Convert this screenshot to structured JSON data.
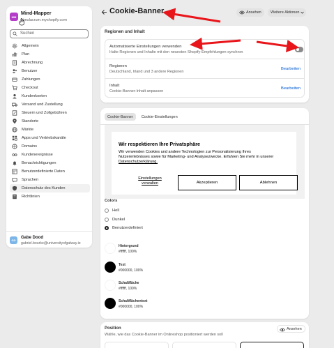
{
  "store": {
    "initials": "MM",
    "name": "Mind-Mapper",
    "url": "simulacrum.myshopify.com"
  },
  "search": {
    "placeholder": "Suchen"
  },
  "nav": [
    {
      "label": "Allgemein",
      "icon": "gear-icon"
    },
    {
      "label": "Plan",
      "icon": "plan-icon"
    },
    {
      "label": "Abrechnung",
      "icon": "billing-icon"
    },
    {
      "label": "Benutzer",
      "icon": "users-icon"
    },
    {
      "label": "Zahlungen",
      "icon": "payments-icon"
    },
    {
      "label": "Checkout",
      "icon": "cart-icon"
    },
    {
      "label": "Kundenkonten",
      "icon": "person-icon"
    },
    {
      "label": "Versand und Zustellung",
      "icon": "truck-icon"
    },
    {
      "label": "Steuern und Zollgebühren",
      "icon": "tax-icon"
    },
    {
      "label": "Standorte",
      "icon": "location-icon"
    },
    {
      "label": "Märkte",
      "icon": "globe-icon"
    },
    {
      "label": "Apps und Vertriebskanäle",
      "icon": "apps-icon"
    },
    {
      "label": "Domains",
      "icon": "domain-icon"
    },
    {
      "label": "Kundenereignisse",
      "icon": "events-icon"
    },
    {
      "label": "Benachrichtigungen",
      "icon": "bell-icon"
    },
    {
      "label": "Benutzerdefinierte Daten",
      "icon": "data-icon"
    },
    {
      "label": "Sprachen",
      "icon": "language-icon"
    },
    {
      "label": "Datenschutz des Kunden",
      "icon": "privacy-icon",
      "active": true
    },
    {
      "label": "Richtlinien",
      "icon": "policy-icon"
    }
  ],
  "user": {
    "initials": "GD",
    "name": "Gabe Dood",
    "email": "gabriel.bourke@universityofgalway.ie"
  },
  "header": {
    "title": "Cookie-Banner",
    "view_label": "Ansehen",
    "more_label": "Weitere Aktionen"
  },
  "regions": {
    "title": "Regionen und Inhalt",
    "auto_title": "Automatisierte Einstellungen verwenden",
    "auto_sub": "Halte Regionen und Inhalte mit den neuesten Shopify-Empfehlungen synchron",
    "auto_enabled": false,
    "regions_title": "Regionen",
    "regions_sub": "Deutschland, Irland und 3 andere Regionen",
    "regions_link": "Bearbeiten",
    "content_title": "Inhalt",
    "content_sub": "Cookie-Banner-Inhalt anpassen",
    "content_link": "Bearbeiten"
  },
  "tabs": [
    {
      "label": "Cookie-Banner",
      "active": true
    },
    {
      "label": "Cookie-Einstellungen",
      "active": false
    }
  ],
  "banner": {
    "title": "Wir respektieren Ihre Privatsphäre",
    "text_line1": "Wir verwenden Cookies und andere Technologien zur Personalisierung Ihres",
    "text_line2": "Nutzererlebnisses sowie für Marketing- und Analysezwecke. Erfahren Sie mehr in unserer",
    "policy_link": "Datenschutzerklärung.",
    "prefs_line1": "Einstellungen",
    "prefs_line2": "verwalten",
    "accept": "Akzeptieren",
    "decline": "Ablehnen"
  },
  "colors": {
    "label": "Colors",
    "options": [
      {
        "label": "Hell",
        "selected": false
      },
      {
        "label": "Dunkel",
        "selected": false
      },
      {
        "label": "Benutzerdefiniert",
        "selected": true
      }
    ],
    "swatches": [
      {
        "name": "Hintergrund",
        "value": "#ffffff, 100%",
        "color": "#ffffff"
      },
      {
        "name": "Text",
        "value": "#000000, 100%",
        "color": "#000000"
      },
      {
        "name": "Schaltfläche",
        "value": "#ffffff, 100%",
        "color": "#ffffff"
      },
      {
        "name": "Schaltflächentext",
        "value": "#000000, 100%",
        "color": "#000000"
      }
    ]
  },
  "position": {
    "title": "Position",
    "sub": "Wähle, wie das Cookie-Banner im Onlineshop positioniert werden soll",
    "view_label": "Ansehen"
  },
  "theme": {
    "accent": "#005bd3",
    "annotation": "#e8161b"
  }
}
